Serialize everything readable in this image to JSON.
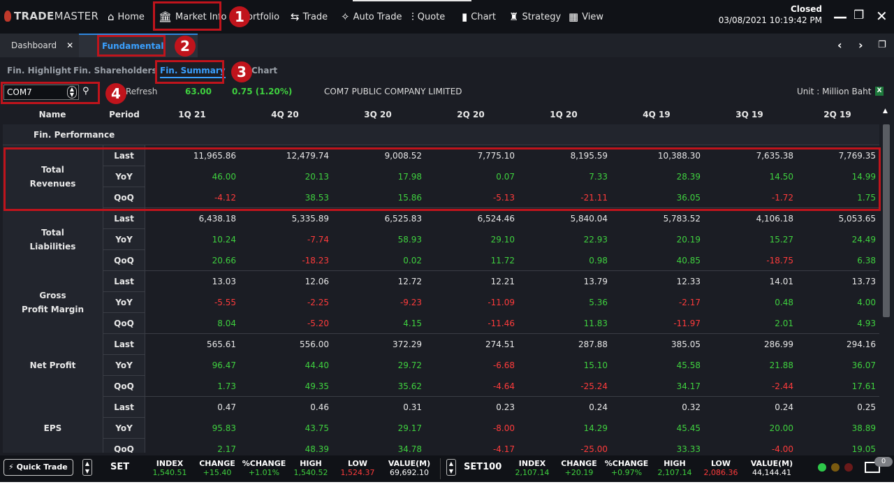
{
  "app": {
    "logo_prefix": "TRADE",
    "logo_suffix": "MASTER",
    "status": "Closed",
    "datetime": "03/08/2021 10:19:42 PM"
  },
  "menu": [
    {
      "label": "Home",
      "icon": "⌂"
    },
    {
      "label": "Market Info",
      "icon": "🏛"
    },
    {
      "label": "ortfolio",
      "icon": ""
    },
    {
      "label": "Trade",
      "icon": "⇆"
    },
    {
      "label": "Auto Trade",
      "icon": "✧"
    },
    {
      "label": "Quote",
      "icon": "⫶"
    },
    {
      "label": "Chart",
      "icon": "▮"
    },
    {
      "label": "Strategy",
      "icon": "♜"
    },
    {
      "label": "View",
      "icon": "▦"
    }
  ],
  "tabs": {
    "dashboard": "Dashboard",
    "close": "✕",
    "fundamental": "Fundamental"
  },
  "subtabs": [
    "Fin. Highlight",
    "Fin. Shareholders",
    "Fin. Summary",
    "Chart"
  ],
  "search": {
    "symbol": "COM7",
    "refresh": "Refresh",
    "price": "63.00",
    "change": "0.75 (1.20%)",
    "company": "COM7 PUBLIC COMPANY LIMITED",
    "unit": "Unit : Million Baht"
  },
  "table": {
    "headers": [
      "Name",
      "Period",
      "1Q 21",
      "4Q 20",
      "3Q 20",
      "2Q 20",
      "1Q 20",
      "4Q 19",
      "3Q 19",
      "2Q 19"
    ],
    "section": "Fin. Performance",
    "groups": [
      {
        "name": "Total\nRevenues",
        "rows": [
          {
            "label": "Last",
            "values": [
              "11,965.86",
              "12,479.74",
              "9,008.52",
              "7,775.10",
              "8,195.59",
              "10,388.30",
              "7,635.38",
              "7,769.35"
            ]
          },
          {
            "label": "YoY",
            "values": [
              "46.00",
              "20.13",
              "17.98",
              "0.07",
              "7.33",
              "28.39",
              "14.50",
              "14.99"
            ]
          },
          {
            "label": "QoQ",
            "values": [
              "-4.12",
              "38.53",
              "15.86",
              "-5.13",
              "-21.11",
              "36.05",
              "-1.72",
              "1.75"
            ]
          }
        ]
      },
      {
        "name": "Total\nLiabilities",
        "rows": [
          {
            "label": "Last",
            "values": [
              "6,438.18",
              "5,335.89",
              "6,525.83",
              "6,524.46",
              "5,840.04",
              "5,783.52",
              "4,106.18",
              "5,053.65"
            ]
          },
          {
            "label": "YoY",
            "values": [
              "10.24",
              "-7.74",
              "58.93",
              "29.10",
              "22.93",
              "20.19",
              "15.27",
              "24.49"
            ]
          },
          {
            "label": "QoQ",
            "values": [
              "20.66",
              "-18.23",
              "0.02",
              "11.72",
              "0.98",
              "40.85",
              "-18.75",
              "6.38"
            ]
          }
        ]
      },
      {
        "name": "Gross\nProfit Margin",
        "rows": [
          {
            "label": "Last",
            "values": [
              "13.03",
              "12.06",
              "12.72",
              "12.21",
              "13.79",
              "12.33",
              "14.01",
              "13.73"
            ]
          },
          {
            "label": "YoY",
            "values": [
              "-5.55",
              "-2.25",
              "-9.23",
              "-11.09",
              "5.36",
              "-2.17",
              "0.48",
              "4.00"
            ]
          },
          {
            "label": "QoQ",
            "values": [
              "8.04",
              "-5.20",
              "4.15",
              "-11.46",
              "11.83",
              "-11.97",
              "2.01",
              "4.93"
            ]
          }
        ]
      },
      {
        "name": "Net Profit",
        "rows": [
          {
            "label": "Last",
            "values": [
              "565.61",
              "556.00",
              "372.29",
              "274.51",
              "287.88",
              "385.05",
              "286.99",
              "294.16"
            ]
          },
          {
            "label": "YoY",
            "values": [
              "96.47",
              "44.40",
              "29.72",
              "-6.68",
              "15.10",
              "45.58",
              "21.88",
              "36.07"
            ]
          },
          {
            "label": "QoQ",
            "values": [
              "1.73",
              "49.35",
              "35.62",
              "-4.64",
              "-25.24",
              "34.17",
              "-2.44",
              "17.61"
            ]
          }
        ]
      },
      {
        "name": "EPS",
        "rows": [
          {
            "label": "Last",
            "values": [
              "0.47",
              "0.46",
              "0.31",
              "0.23",
              "0.24",
              "0.32",
              "0.24",
              "0.25"
            ]
          },
          {
            "label": "YoY",
            "values": [
              "95.83",
              "43.75",
              "29.17",
              "-8.00",
              "14.29",
              "45.45",
              "20.00",
              "38.89"
            ]
          },
          {
            "label": "QoQ",
            "values": [
              "2.17",
              "48.39",
              "34.78",
              "-4.17",
              "-25.00",
              "33.33",
              "-4.00",
              "19.05"
            ]
          }
        ]
      }
    ]
  },
  "bottom": {
    "quick_trade": "Quick Trade",
    "markets": [
      {
        "name": "SET",
        "stats": [
          {
            "key": "INDEX",
            "value": "1,540.51",
            "color": "#3fd13f"
          },
          {
            "key": "CHANGE",
            "value": "+15.40",
            "color": "#3fd13f"
          },
          {
            "key": "%CHANGE",
            "value": "+1.01%",
            "color": "#3fd13f"
          },
          {
            "key": "HIGH",
            "value": "1,540.52",
            "color": "#3fd13f"
          },
          {
            "key": "LOW",
            "value": "1,524.37",
            "color": "#ff3b3b"
          },
          {
            "key": "VALUE(M)",
            "value": "69,692.10",
            "color": "#ffffff"
          }
        ]
      },
      {
        "name": "SET100",
        "stats": [
          {
            "key": "INDEX",
            "value": "2,107.14",
            "color": "#3fd13f"
          },
          {
            "key": "CHANGE",
            "value": "+20.19",
            "color": "#3fd13f"
          },
          {
            "key": "%CHANGE",
            "value": "+0.97%",
            "color": "#3fd13f"
          },
          {
            "key": "HIGH",
            "value": "2,107.14",
            "color": "#3fd13f"
          },
          {
            "key": "LOW",
            "value": "2,086.36",
            "color": "#ff3b3b"
          },
          {
            "key": "VALUE(M)",
            "value": "44,144.41",
            "color": "#ffffff"
          }
        ]
      }
    ],
    "mail_count": "0"
  },
  "annotations": [
    "1",
    "2",
    "3",
    "4"
  ],
  "colors": {
    "positive": "#3fd13f",
    "negative": "#ff3b3b",
    "accent": "#3aa0ff",
    "highlight": "#c0141c"
  }
}
